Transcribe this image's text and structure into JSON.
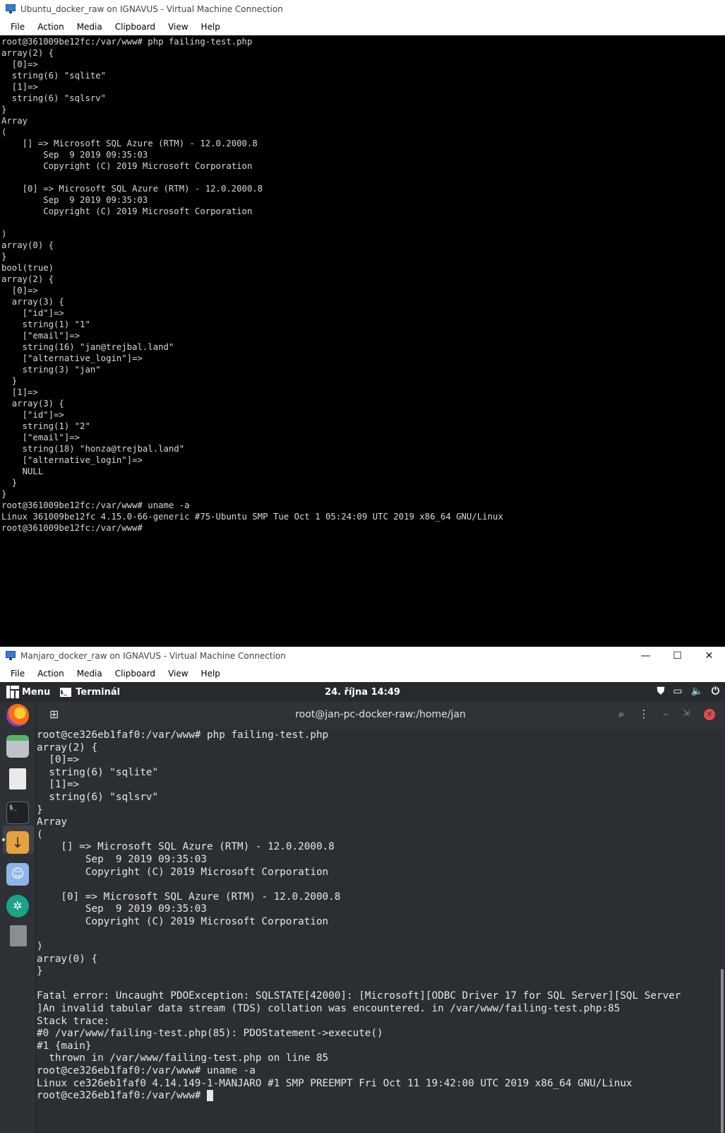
{
  "window1": {
    "title": "Ubuntu_docker_raw on IGNAVUS - Virtual Machine Connection",
    "menu": [
      "File",
      "Action",
      "Media",
      "Clipboard",
      "View",
      "Help"
    ],
    "terminal_text": "root@361009be12fc:/var/www# php failing-test.php\narray(2) {\n  [0]=>\n  string(6) \"sqlite\"\n  [1]=>\n  string(6) \"sqlsrv\"\n}\nArray\n(\n    [] => Microsoft SQL Azure (RTM) - 12.0.2000.8\n        Sep  9 2019 09:35:03\n        Copyright (C) 2019 Microsoft Corporation\n\n    [0] => Microsoft SQL Azure (RTM) - 12.0.2000.8\n        Sep  9 2019 09:35:03\n        Copyright (C) 2019 Microsoft Corporation\n\n)\narray(0) {\n}\nbool(true)\narray(2) {\n  [0]=>\n  array(3) {\n    [\"id\"]=>\n    string(1) \"1\"\n    [\"email\"]=>\n    string(16) \"jan@trejbal.land\"\n    [\"alternative_login\"]=>\n    string(3) \"jan\"\n  }\n  [1]=>\n  array(3) {\n    [\"id\"]=>\n    string(1) \"2\"\n    [\"email\"]=>\n    string(18) \"honza@trejbal.land\"\n    [\"alternative_login\"]=>\n    NULL\n  }\n}\nroot@361009be12fc:/var/www# uname -a\nLinux 361009be12fc 4.15.0-66-generic #75-Ubuntu SMP Tue Oct 1 05:24:09 UTC 2019 x86_64 GNU/Linux\nroot@361009be12fc:/var/www#"
  },
  "window2": {
    "title": "Manjaro_docker_raw on IGNAVUS - Virtual Machine Connection",
    "controls": {
      "minimize": "—",
      "maximize": "☐",
      "close": "✕"
    },
    "menu": [
      "File",
      "Action",
      "Media",
      "Clipboard",
      "View",
      "Help"
    ],
    "panel": {
      "menu_label": "Menu",
      "app_label": "Terminál",
      "clock": "24. října  14:49",
      "term_icon_text": "$_"
    },
    "terminal_header": {
      "title": "root@jan-pc-docker-raw:/home/jan",
      "newtab_icon": "⊞",
      "search_icon": "⌕",
      "menu_icon": "⋮",
      "min_icon": "–",
      "restore_icon": "⇲",
      "close_icon": "✕"
    },
    "terminal_text": "root@ce326eb1faf0:/var/www# php failing-test.php\narray(2) {\n  [0]=>\n  string(6) \"sqlite\"\n  [1]=>\n  string(6) \"sqlsrv\"\n}\nArray\n(\n    [] => Microsoft SQL Azure (RTM) - 12.0.2000.8\n        Sep  9 2019 09:35:03\n        Copyright (C) 2019 Microsoft Corporation\n\n    [0] => Microsoft SQL Azure (RTM) - 12.0.2000.8\n        Sep  9 2019 09:35:03\n        Copyright (C) 2019 Microsoft Corporation\n\n)\narray(0) {\n}\n\nFatal error: Uncaught PDOException: SQLSTATE[42000]: [Microsoft][ODBC Driver 17 for SQL Server][SQL Server\n]An invalid tabular data stream (TDS) collation was encountered. in /var/www/failing-test.php:85\nStack trace:\n#0 /var/www/failing-test.php(85): PDOStatement->execute()\n#1 {main}\n  thrown in /var/www/failing-test.php on line 85\nroot@ce326eb1faf0:/var/www# uname -a\nLinux ce326eb1faf0 4.14.149-1-MANJARO #1 SMP PREEMPT Fri Oct 11 19:42:00 UTC 2019 x86_64 GNU/Linux\nroot@ce326eb1faf0:/var/www# "
  }
}
